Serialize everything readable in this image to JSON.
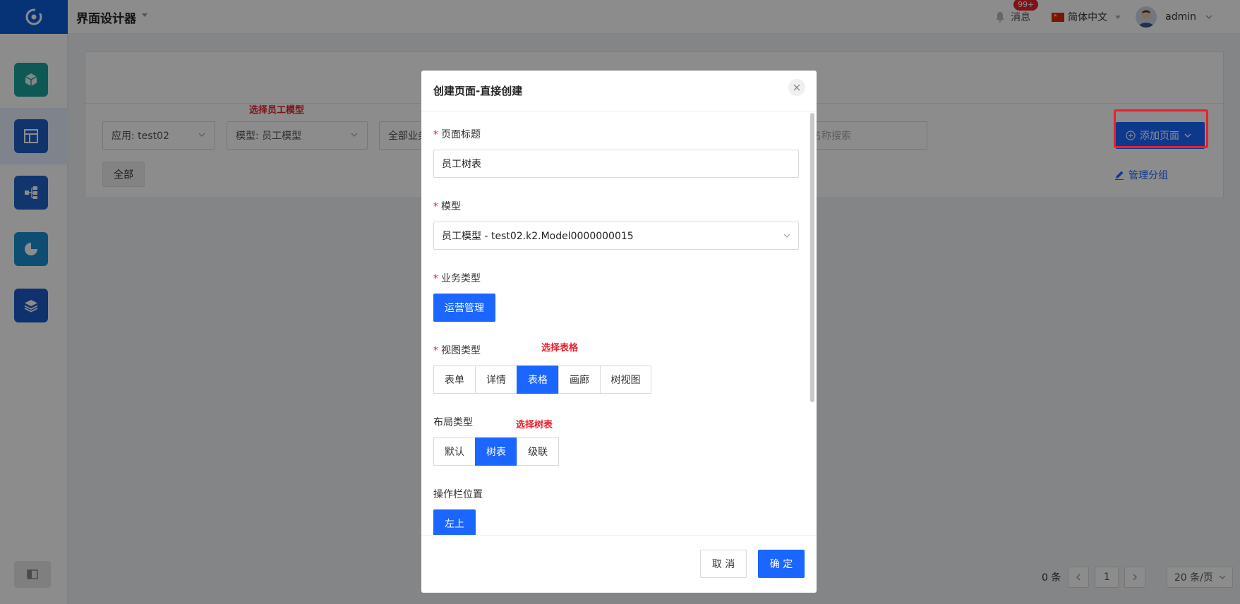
{
  "app": {
    "title": "界面设计器"
  },
  "header": {
    "messages_label": "消息",
    "badge": "99+",
    "language": "简体中文",
    "username": "admin"
  },
  "filters": {
    "app_select": "应用: test02",
    "model_select": "模型: 员工模型",
    "business_select": "全部业务",
    "search_placeholder": "名称搜索",
    "all_button": "全部"
  },
  "actions": {
    "add_page": "添加页面",
    "manage_groups": "管理分组"
  },
  "annotations": {
    "select_model": "选择员工模型",
    "select_table": "选择表格",
    "select_tree": "选择树表"
  },
  "pagination": {
    "total": "0 条",
    "current_page": "1",
    "page_size": "20 条/页"
  },
  "modal": {
    "title": "创建页面-直接创建",
    "page_title_label": "页面标题",
    "page_title_value": "员工树表",
    "model_label": "模型",
    "model_value": "员工模型 - test02.k2.Model0000000015",
    "business_type_label": "业务类型",
    "business_type_value": "运营管理",
    "view_type_label": "视图类型",
    "view_types": [
      "表单",
      "详情",
      "表格",
      "画廊",
      "树视图"
    ],
    "view_type_selected": "表格",
    "layout_type_label": "布局类型",
    "layout_types": [
      "默认",
      "树表",
      "级联"
    ],
    "layout_type_selected": "树表",
    "action_bar_label": "操作栏位置",
    "action_bar_value": "左上",
    "cancel_label": "取 消",
    "ok_label": "确 定"
  },
  "colors": {
    "primary": "#1a66ff",
    "danger": "#e8212d",
    "logo_bg": "#0b5bd7"
  }
}
